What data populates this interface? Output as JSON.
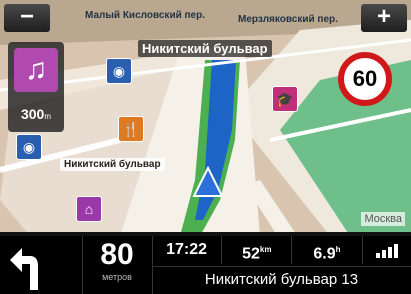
{
  "map": {
    "zoom_out_label": "−",
    "zoom_in_label": "+",
    "top_streets": [
      "Малый Кисловский пер.",
      "Мерзляковский пер."
    ],
    "main_street_label": "Никитский бульвар",
    "side_street_label": "Никитский бульвар",
    "city_label": "Москва",
    "speed_limit": "60"
  },
  "poi_panel": {
    "icon": "music-icon",
    "distance": "300",
    "distance_unit": "m"
  },
  "bottom": {
    "turn_icon": "turn-left-arrow-icon",
    "distance_value": "80",
    "distance_unit": "метров",
    "time": "17:22",
    "remaining_distance": "52",
    "remaining_distance_unit": "km",
    "remaining_time": "6.9",
    "remaining_time_unit": "h",
    "signal_icon": "gps-signal-icon",
    "current_street": "Никитский бульвар 13"
  }
}
